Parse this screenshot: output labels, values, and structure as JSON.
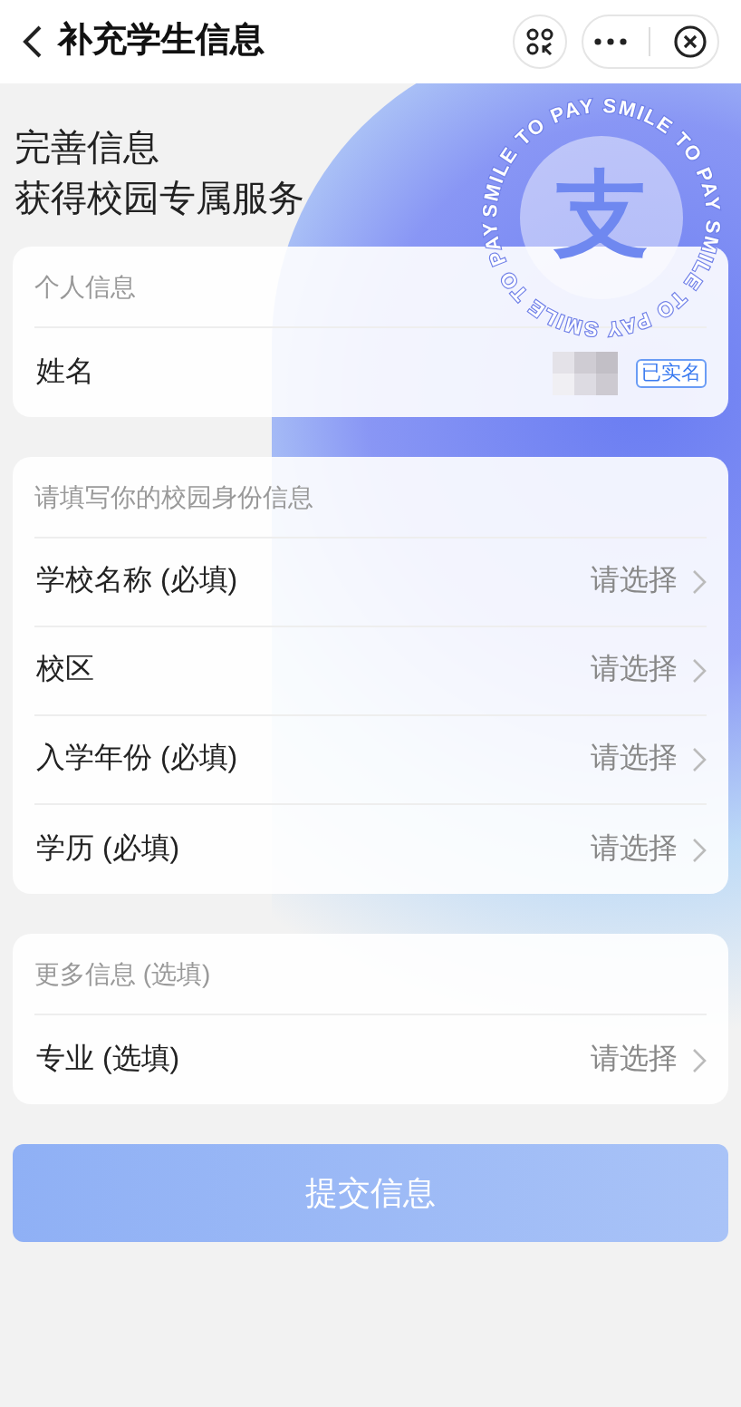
{
  "header": {
    "title": "补充学生信息"
  },
  "intro": {
    "lines": [
      "完善信息",
      "获得校园专属服务"
    ],
    "emblem": {
      "glyph": "支",
      "ring_text": "SMILE TO PAY SMILE TO PAY SMILE TO PAY SMILE TO PAY"
    }
  },
  "sections": [
    {
      "title": "个人信息",
      "rows": [
        {
          "kind": "verified",
          "label": "姓名",
          "badge": "已实名"
        }
      ]
    },
    {
      "title": "请填写你的校园身份信息",
      "rows": [
        {
          "kind": "select",
          "label": "学校名称 (必填)",
          "value": "请选择"
        },
        {
          "kind": "select",
          "label": "校区",
          "value": "请选择"
        },
        {
          "kind": "select",
          "label": "入学年份 (必填)",
          "value": "请选择"
        },
        {
          "kind": "select",
          "label": "学历 (必填)",
          "value": "请选择"
        }
      ]
    },
    {
      "title": "更多信息 (选填)",
      "rows": [
        {
          "kind": "select",
          "label": "专业 (选填)",
          "value": "请选择"
        }
      ]
    }
  ],
  "submit": {
    "label": "提交信息",
    "disabled": true
  }
}
